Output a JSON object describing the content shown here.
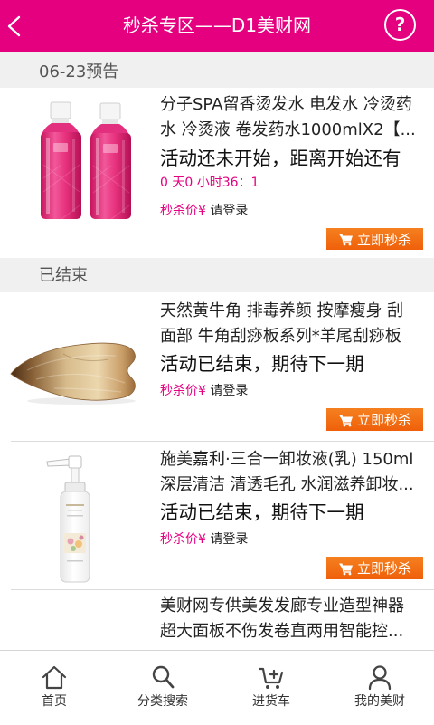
{
  "colors": {
    "brand": "#e5007f",
    "button": "#f26d14",
    "section_bg": "#f0f0f0"
  },
  "header": {
    "title": "秒杀专区——D1美财网",
    "back_icon": "chevron-left-icon",
    "help_icon": "help-circle-icon",
    "help_glyph": "?"
  },
  "sections": [
    {
      "title": "06-23预告"
    },
    {
      "title": "已结束"
    }
  ],
  "products": [
    {
      "title_lines": [
        "分子SPA留香烫发水 电发水 冷烫药",
        "水 冷烫液 卷发药水1000mlX2【..."
      ],
      "status": "活动还未开始，距离开始还有",
      "countdown": "0 天0 小时36：1",
      "price_label": "秒杀价¥",
      "price_value": "请登录",
      "button_label": "立即秒杀"
    },
    {
      "title_lines": [
        "天然黄牛角 排毒养颜 按摩瘦身 刮",
        "面部 牛角刮痧板系列*羊尾刮痧板"
      ],
      "status": "活动已结束，期待下一期",
      "price_label": "秒杀价¥",
      "price_value": "请登录",
      "button_label": "立即秒杀"
    },
    {
      "title_lines": [
        "施美嘉利·三合一卸妆液(乳) 150ml",
        "深层清洁 清透毛孔 水润滋养卸妆..."
      ],
      "status": "活动已结束，期待下一期",
      "price_label": "秒杀价¥",
      "price_value": "请登录",
      "button_label": "立即秒杀"
    },
    {
      "title_lines": [
        "美财网专供美发发廊专业造型神器",
        "超大面板不伤发卷直两用智能控..."
      ]
    }
  ],
  "tabbar": {
    "items": [
      {
        "label": "首页",
        "icon": "home-icon"
      },
      {
        "label": "分类搜索",
        "icon": "search-icon"
      },
      {
        "label": "进货车",
        "icon": "cart-add-icon"
      },
      {
        "label": "我的美财",
        "icon": "user-icon"
      }
    ]
  }
}
